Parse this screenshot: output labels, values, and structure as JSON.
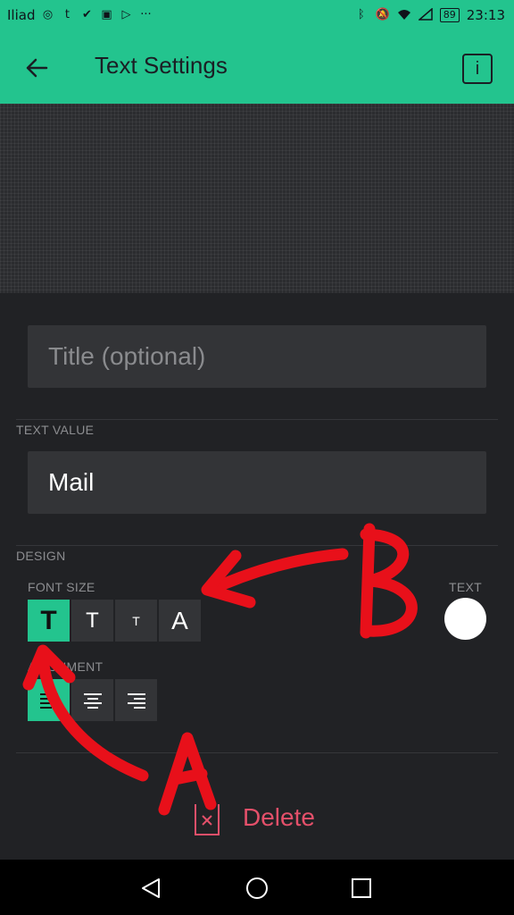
{
  "status_bar": {
    "carrier": "Iliad",
    "time": "23:13",
    "battery": "89",
    "left_icons": [
      "instagram-icon",
      "tumblr-icon",
      "tag-icon",
      "photo-icon",
      "play-icon",
      "more-icon"
    ],
    "right_icons": [
      "bluetooth-icon",
      "mute-icon",
      "wifi-icon",
      "signal-icon"
    ]
  },
  "app_bar": {
    "title": "Text Settings",
    "info_label": "i"
  },
  "form": {
    "title_placeholder": "Title (optional)",
    "text_value_label": "TEXT VALUE",
    "text_value": "Mail",
    "design_label": "DESIGN",
    "font_size_label": "FONT SIZE",
    "font_size_options": [
      "T",
      "T",
      "T",
      "A"
    ],
    "font_size_selected": 0,
    "alignment_label": "ALIGNMENT",
    "alignment_selected": 0,
    "text_color_label": "TEXT",
    "text_color": "#ffffff"
  },
  "actions": {
    "delete_label": "Delete"
  },
  "annotations": {
    "label_a": "A",
    "label_b": "B",
    "color": "#e8101a"
  },
  "colors": {
    "accent": "#23c48e",
    "background": "#212225",
    "field": "#333437",
    "danger": "#e4506a"
  }
}
